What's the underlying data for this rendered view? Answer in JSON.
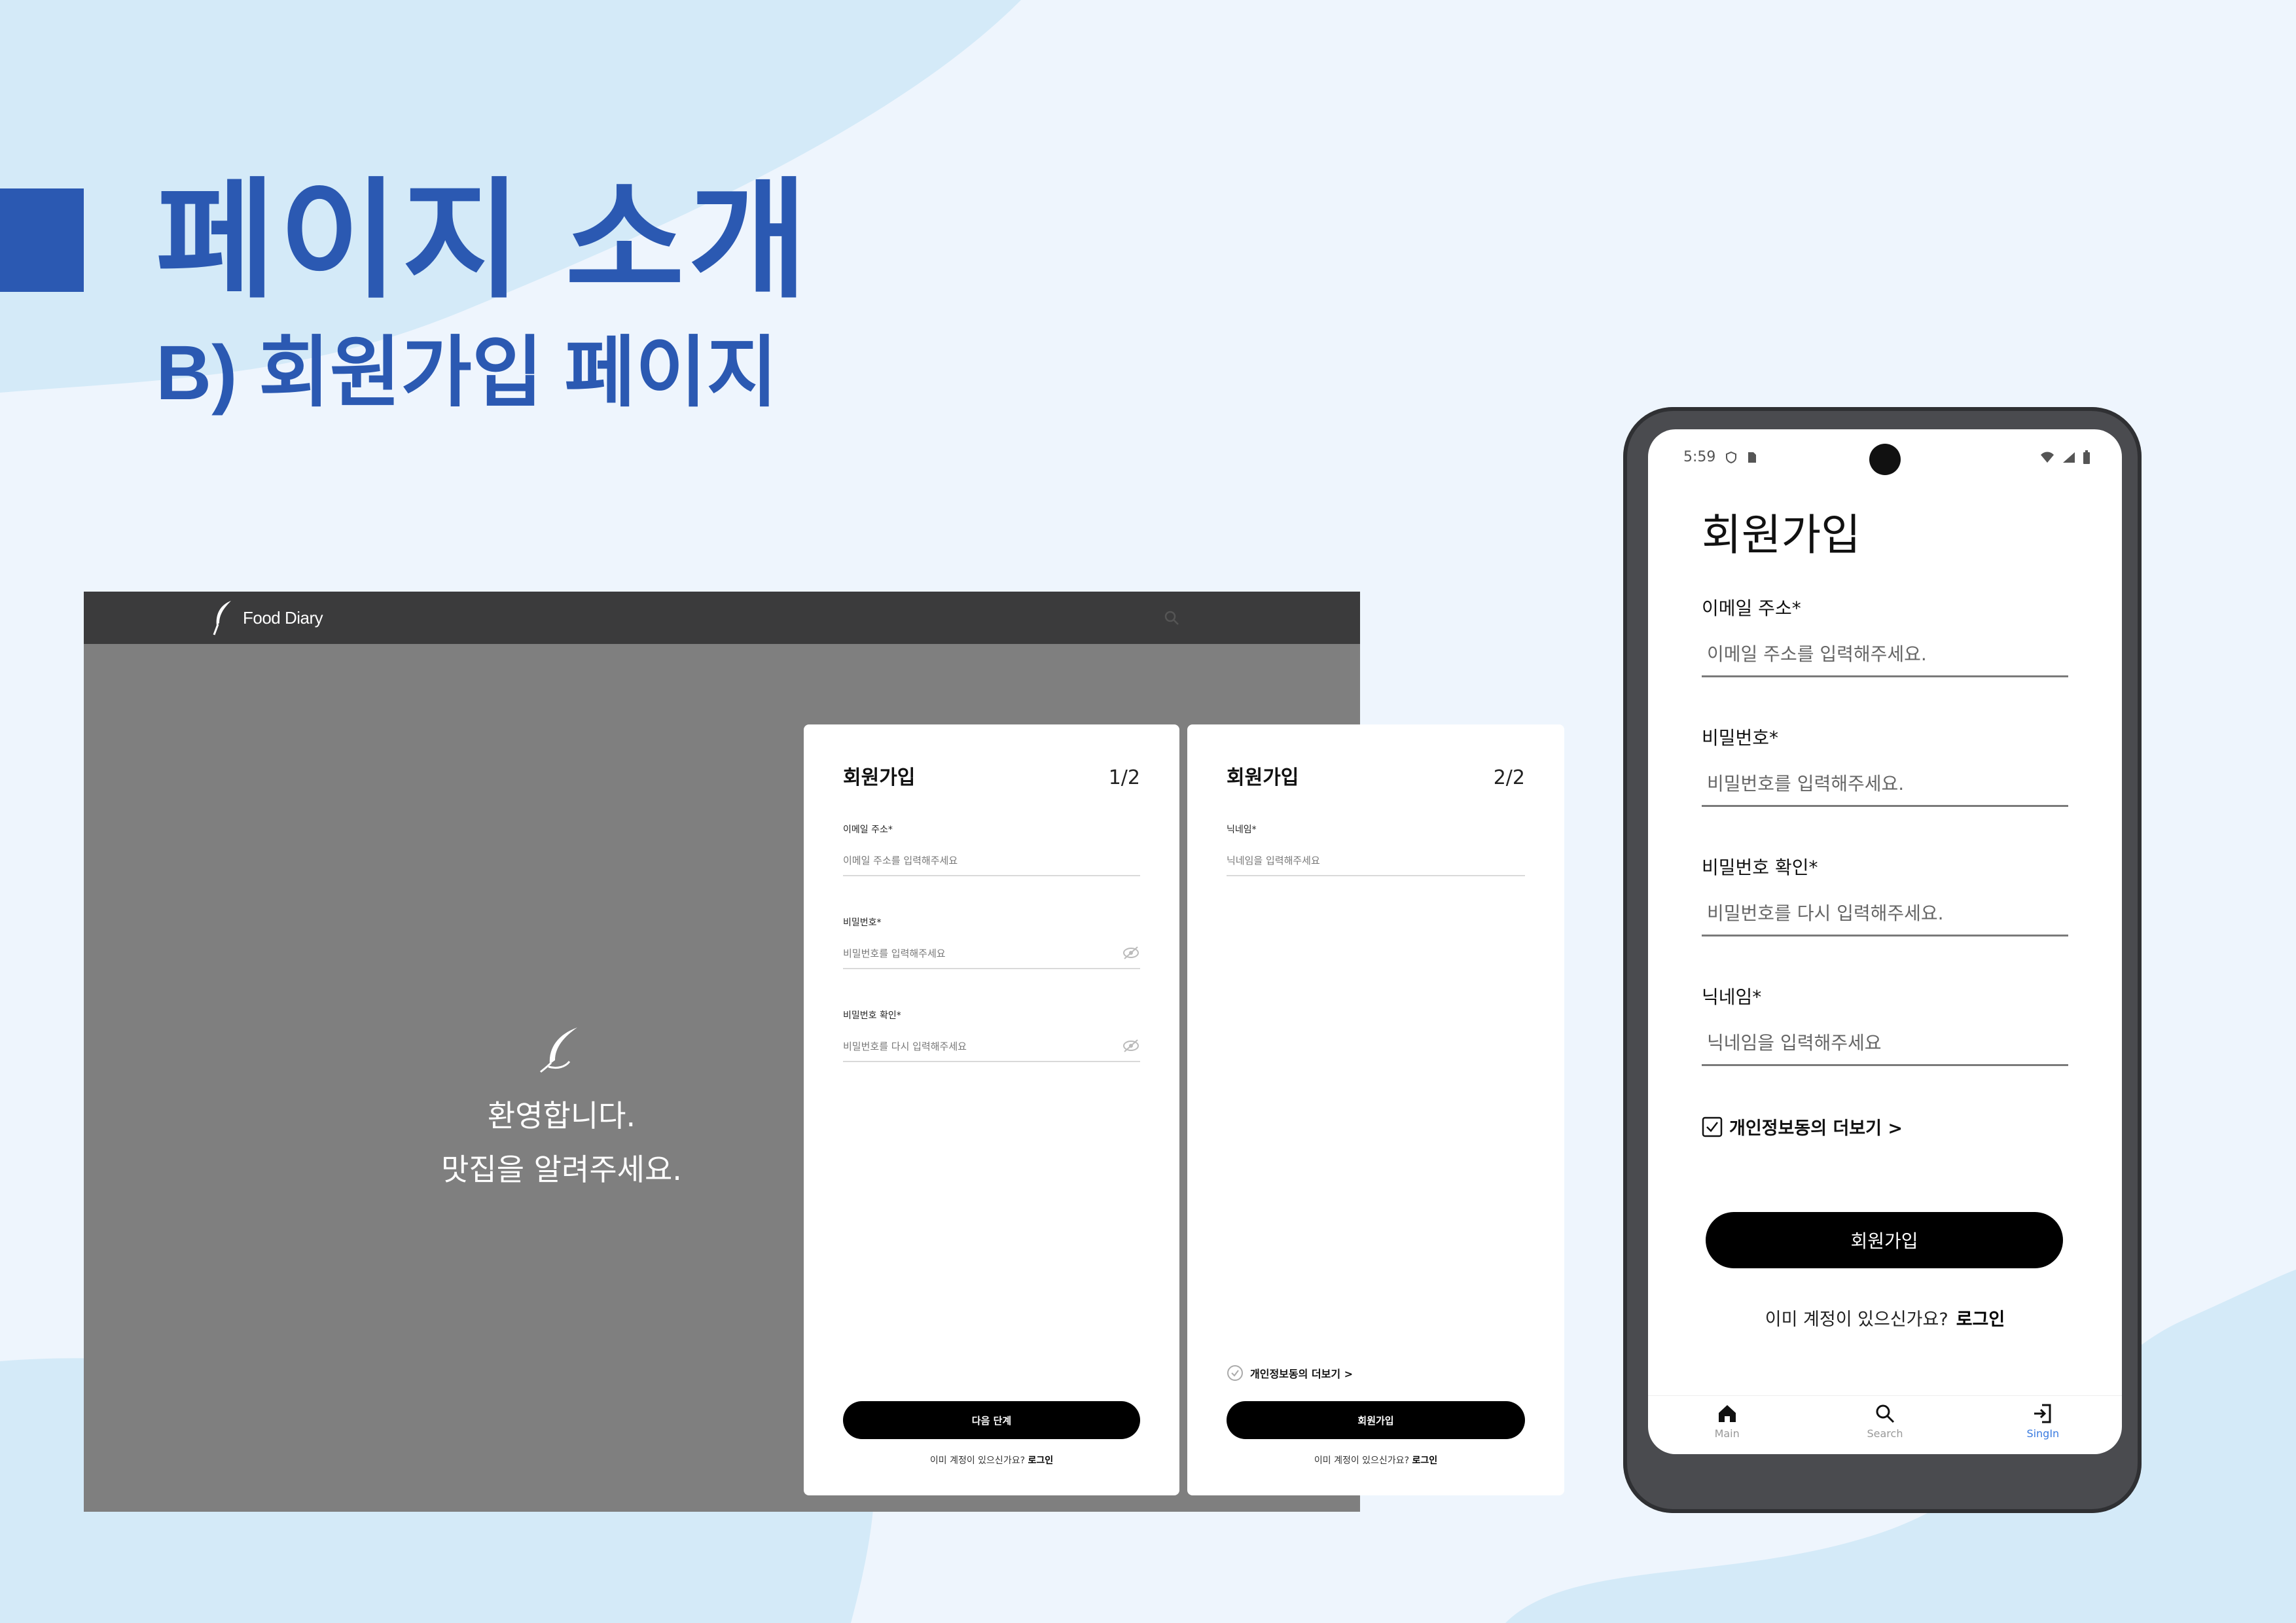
{
  "slide": {
    "title": "페이지 소개",
    "subtitle": "B) 회원가입 페이지",
    "accent_color": "#2b59b2"
  },
  "desktop": {
    "brand": "Food Diary",
    "icons": {
      "logo": "feather-icon",
      "search": "search-icon"
    },
    "hero": {
      "line1": "환영합니다.",
      "line2": "맛집을 알려주세요."
    },
    "step1": {
      "title": "회원가입",
      "step": "1/2",
      "fields": [
        {
          "label": "이메일 주소*",
          "placeholder": "이메일 주소를 입력해주세요"
        },
        {
          "label": "비밀번호*",
          "placeholder": "비밀번호를 입력해주세요"
        },
        {
          "label": "비밀번호 확인*",
          "placeholder": "비밀번호를 다시 입력해주세요"
        }
      ],
      "button": "다음 단계",
      "login_prompt": "이미 계정이 있으신가요?",
      "login_link": "로그인"
    },
    "step2": {
      "title": "회원가입",
      "step": "2/2",
      "fields": [
        {
          "label": "닉네임*",
          "placeholder": "닉네임을 입력해주세요"
        }
      ],
      "consent": "개인정보동의 더보기 >",
      "button": "회원가입",
      "login_prompt": "이미 계정이 있으신가요?",
      "login_link": "로그인"
    }
  },
  "mobile": {
    "status": {
      "time": "5:59"
    },
    "title": "회원가입",
    "fields": [
      {
        "label": "이메일 주소*",
        "placeholder": "이메일 주소를 입력해주세요."
      },
      {
        "label": "비밀번호*",
        "placeholder": "비밀번호를 입력해주세요."
      },
      {
        "label": "비밀번호 확인*",
        "placeholder": "비밀번호를 다시 입력해주세요."
      },
      {
        "label": "닉네임*",
        "placeholder": "닉네임을 입력해주세요"
      }
    ],
    "consent": {
      "label": "개인정보동의 더보기 >",
      "checked": true
    },
    "button": "회원가입",
    "login_prompt": "이미 계정이 있으신가요?",
    "login_link": "로그인",
    "nav": [
      {
        "label": "Main",
        "icon": "home-icon",
        "active": false
      },
      {
        "label": "Search",
        "icon": "search-icon",
        "active": false
      },
      {
        "label": "SingIn",
        "icon": "login-icon",
        "active": true
      }
    ],
    "nav_active_color": "#3a7be0"
  }
}
